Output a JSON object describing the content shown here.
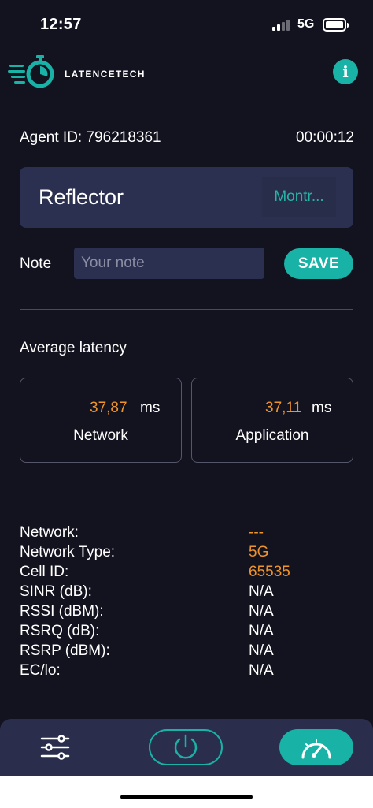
{
  "status_bar": {
    "time": "12:57",
    "network": "5G"
  },
  "header": {
    "brand": "LATENCETECH",
    "info_label": "i"
  },
  "agent": {
    "label": "Agent ID: 796218361",
    "timer": "00:00:12"
  },
  "reflector": {
    "label": "Reflector",
    "value": "Montr..."
  },
  "note": {
    "label": "Note",
    "placeholder": "Your note",
    "save_label": "SAVE"
  },
  "latency": {
    "title": "Average latency",
    "network": {
      "value": "37,87",
      "unit": "ms",
      "label": "Network"
    },
    "application": {
      "value": "37,11",
      "unit": "ms",
      "label": "Application"
    }
  },
  "info": [
    {
      "key": "Network:",
      "value": "---"
    },
    {
      "key": "Network Type:",
      "value": "5G"
    },
    {
      "key": "Cell ID:",
      "value": "65535"
    },
    {
      "key": "SINR (dB):",
      "value": "N/A"
    },
    {
      "key": "RSSI (dBM):",
      "value": "N/A"
    },
    {
      "key": "RSRQ (dB):",
      "value": "N/A"
    },
    {
      "key": "RSRP (dBM):",
      "value": "N/A"
    },
    {
      "key": "EC/lo:",
      "value": "N/A"
    }
  ],
  "colors": {
    "accent": "#19b2a6",
    "highlight": "#f0932b",
    "background": "#13131f",
    "card": "#2b3050"
  },
  "icons": [
    "stopwatch-logo-icon",
    "info-icon",
    "sliders-icon",
    "power-icon",
    "speedometer-icon"
  ]
}
